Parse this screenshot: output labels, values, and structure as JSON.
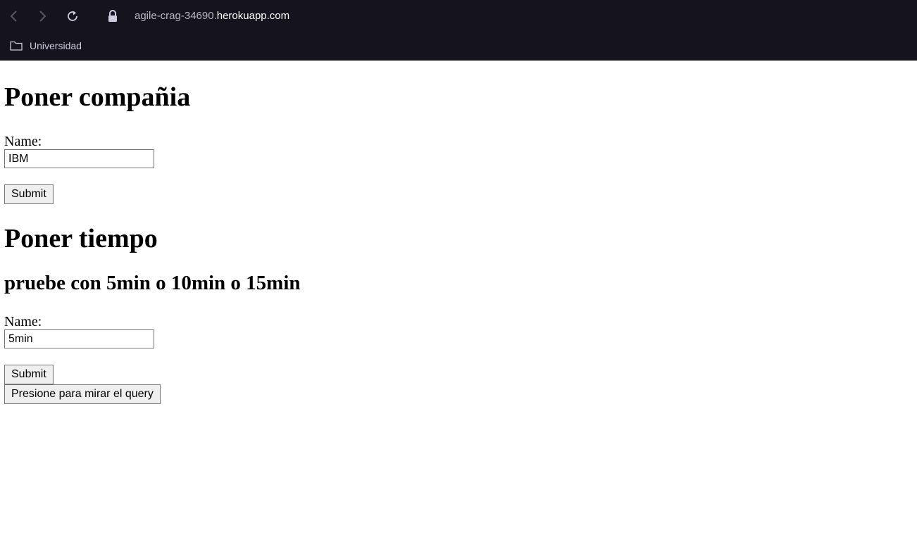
{
  "browser": {
    "url_subdomain": "agile-crag-34690.",
    "url_domain": "herokuapp.com",
    "bookmark_folder": "Universidad",
    "icons": [
      "back-icon",
      "forward-icon",
      "reload-icon",
      "lock-icon",
      "folder-icon"
    ]
  },
  "form_company": {
    "heading": "Poner compañia",
    "label": "Name:",
    "value": "IBM",
    "submit": "Submit"
  },
  "form_time": {
    "heading": "Poner tiempo",
    "hint": "pruebe con 5min o 10min o 15min",
    "label": "Name:",
    "value": "5min",
    "submit": "Submit"
  },
  "query_button": "Presione para mirar el query"
}
